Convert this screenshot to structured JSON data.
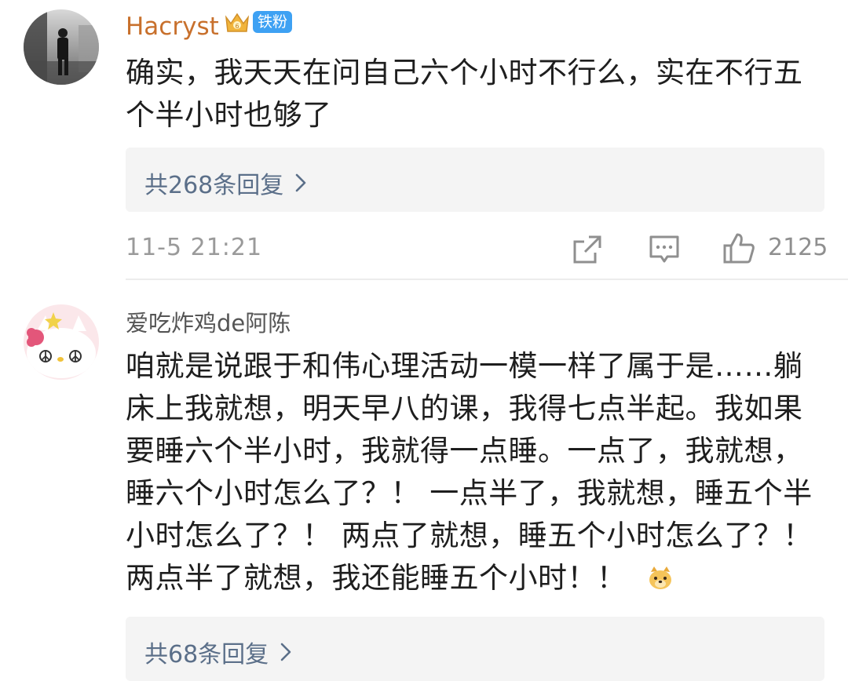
{
  "comments": [
    {
      "username": "Hacryst",
      "username_color": "#c8702c",
      "fan_badge": "铁粉",
      "text_lines": [
        "确实，我天天在问自己六个小时不行么，实在不行五",
        "个半小时也够了"
      ],
      "reply_label": "共268条回复",
      "timestamp": "11-5 21:21",
      "like_count": "2125"
    },
    {
      "username": "爱吃炸鸡de阿陈",
      "username_color": "#555555",
      "text_lines": [
        "咱就是说跟于和伟心理活动一模一样了属于是……躺",
        "床上我就想，明天早八的课，我得七点半起。我如果",
        "要睡六个半小时，我就得一点睡。一点了，我就想，",
        "睡六个小时怎么了？！ 一点半了，我就想，睡五个半",
        "小时怎么了？！ 两点了就想，睡五个小时怎么了？！",
        "两点半了就想，我还能睡五个小时！！"
      ],
      "reply_label": "共68条回复"
    }
  ],
  "icons": {
    "reply_chevron": "chevron-right-icon",
    "share": "share-icon",
    "comment": "comment-icon",
    "like": "thumbs-up-icon",
    "emoji": "dog-emoji-icon"
  },
  "colors": {
    "link": "#5b6f89",
    "meta": "#9a9a9a",
    "fan_badge_bg": "#3ea1f3"
  }
}
